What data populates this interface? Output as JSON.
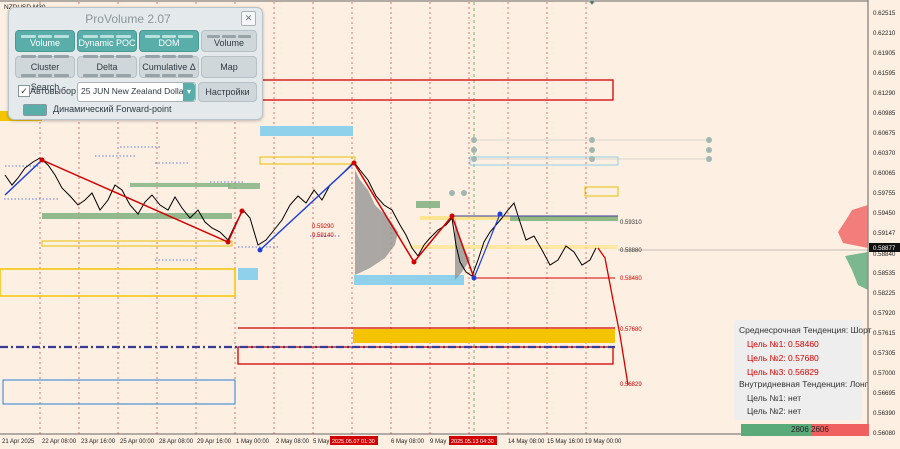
{
  "chart": {
    "symbol": "NZDUSD,M30",
    "price_ticks": [
      "0.62515",
      "0.62210",
      "0.61905",
      "0.61595",
      "0.61290",
      "0.60985",
      "0.60675",
      "0.60370",
      "0.60065",
      "0.59755",
      "0.59450",
      "0.59147",
      "0.58840",
      "0.58535",
      "0.58225",
      "0.57920",
      "0.57615",
      "0.57305",
      "0.57000",
      "0.56695",
      "0.56390",
      "0.56080"
    ],
    "time_ticks": [
      "21 Apr 2025",
      "22 Apr 08:00",
      "23 Apr 16:00",
      "25 Apr 00:00",
      "28 Apr 08:00",
      "29 Apr 16:00",
      "1 May 00:00",
      "2 May 08:00",
      "5 May",
      "6 May 08:00",
      "9 May",
      "14 May 08:00",
      "15 May 16:00",
      "19 May 00:00"
    ],
    "time_highlights": [
      "2025.05.07 01:30",
      "2025.05.13 04:30"
    ],
    "current_price": "0.58877",
    "level_labels": {
      "l1": "0.59310",
      "l2": "0.58880",
      "l3": "0.58460",
      "l4": "0.57680",
      "l5": "0.56829",
      "l6": "0.59290",
      "l7": "0.59140"
    }
  },
  "panel": {
    "title": "ProVolume 2.07",
    "close": "✕",
    "buttons": {
      "volume_profile": "Volume Profile",
      "dynamic_poc": "Dynamic POC",
      "dom": "DOM",
      "volume": "Volume",
      "cluster_search": "Cluster Search",
      "delta": "Delta",
      "cumulative": "Cumulative Δ",
      "map": "Map"
    },
    "auto_select_label": "Автовыбор",
    "auto_select_checked": "✓",
    "instrument": "25 JUN New Zealand Dollar",
    "settings": "Настройки",
    "forward_point": "Динамический Forward-point"
  },
  "forecast": {
    "mid_trend": "Среднесрочная Тенденция: Шорт",
    "t1": "Цель №1: 0.58460",
    "t2": "Цель №2: 0.57680",
    "t3": "Цель №3: 0.56829",
    "intraday_trend": "Внутридневная Тенденция: Лонг",
    "i1": "Цель №1: нет",
    "i2": "Цель №2: нет"
  },
  "volume_bar": {
    "buy": "2806",
    "sell": "2606",
    "buy_color": "#5aaa7a",
    "sell_color": "#f06060"
  },
  "colors": {
    "background": "#fdf0e2",
    "bearish_line": "#d20000",
    "bullish_line": "#1f3fd8",
    "accent": "#5aaeaa",
    "zone_gold": "#f5c400",
    "zone_blue": "#8fd0ea",
    "zone_green": "#7fb07f"
  }
}
